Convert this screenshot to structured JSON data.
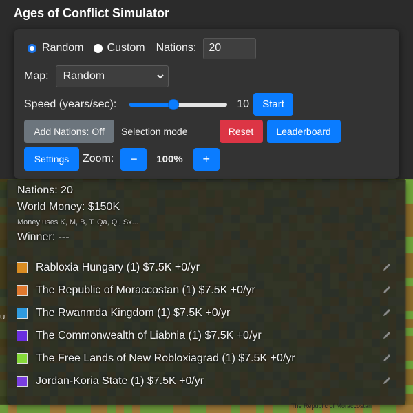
{
  "app": {
    "title": "Ages of Conflict Simulator"
  },
  "mode": {
    "random_label": "Random",
    "custom_label": "Custom",
    "selected": "Random",
    "nations_label": "Nations:",
    "nations_value": "20"
  },
  "map": {
    "label": "Map:",
    "selected": "Random"
  },
  "speed": {
    "label": "Speed (years/sec):",
    "value": "10",
    "slider_fraction": 0.45,
    "start_label": "Start"
  },
  "toolbar": {
    "add_nations_label": "Add Nations: Off",
    "selection_mode_label": "Selection mode",
    "reset_label": "Reset",
    "leaderboard_label": "Leaderboard",
    "settings_label": "Settings",
    "zoom_label": "Zoom:",
    "zoom_minus": "−",
    "zoom_value": "100%",
    "zoom_plus": "+"
  },
  "stats": {
    "nations": "Nations: 20",
    "world_money": "World Money: $150K",
    "money_note": "Money uses K, M, B, T, Qa, Qi, Sx...",
    "winner": "Winner: ---"
  },
  "nations": [
    {
      "text": "Rabloxia Hungary (1) $7.5K +0/yr",
      "color": "#d98c22"
    },
    {
      "text": "The Republic of Moraccostan (1) $7.5K +0/yr",
      "color": "#e0782e"
    },
    {
      "text": "The Rwanmda Kingdom (1) $7.5K +0/yr",
      "color": "#2f9be0"
    },
    {
      "text": "The Commonwealth of Liabnia (1) $7.5K +0/yr",
      "color": "#6a2fe0"
    },
    {
      "text": "The Free Lands of New Robloxiagrad (1) $7.5K +0/yr",
      "color": "#86d93a"
    },
    {
      "text": "Jordan-Koria State (1) $7.5K +0/yr",
      "color": "#7a3ee0"
    }
  ],
  "map_labels": {
    "bottom": "The Republic of Moraccostan",
    "left": "U"
  },
  "colors": {
    "accent": "#0a7cff",
    "danger": "#dc3545",
    "neutral": "#6c757d",
    "panel": "#333333"
  },
  "icons": {
    "edit": "pencil-icon",
    "radio_on": "radio-checked-icon",
    "radio_off": "radio-unchecked-icon",
    "dropdown": "chevron-down-icon"
  }
}
